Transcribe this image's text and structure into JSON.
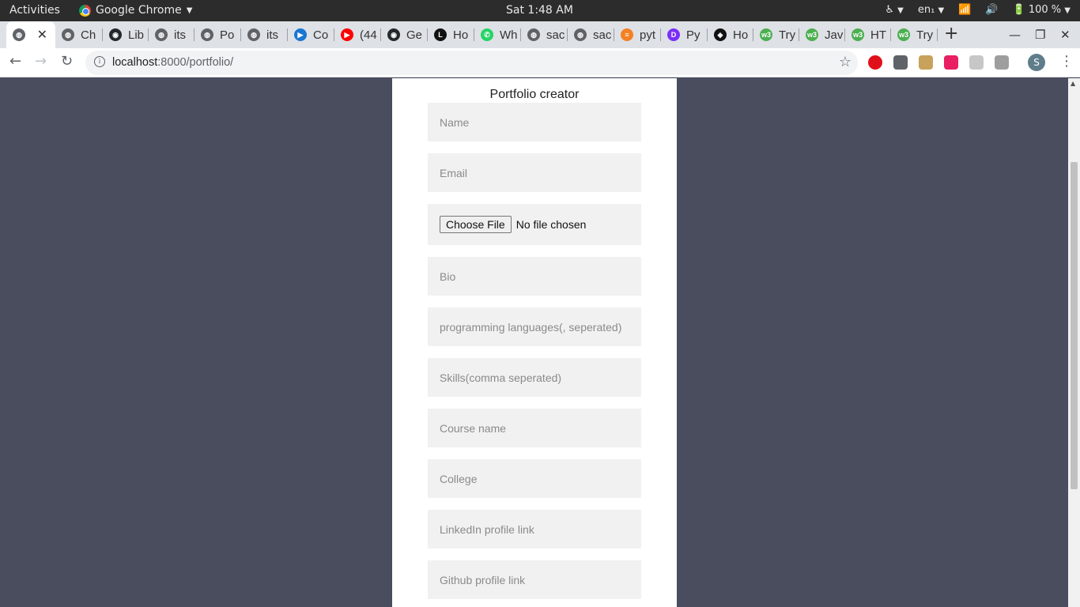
{
  "system": {
    "activities": "Activities",
    "app_name": "Google Chrome",
    "clock": "Sat  1:48 AM",
    "lang": "en₁",
    "battery": "100 %"
  },
  "tabs": [
    {
      "label": "",
      "favicon": "globe-icon",
      "color": "#5f6368",
      "active": true
    },
    {
      "label": "Ch",
      "favicon": "globe-icon",
      "color": "#5f6368"
    },
    {
      "label": "Lib",
      "favicon": "github-icon",
      "color": "#24292e"
    },
    {
      "label": "its",
      "favicon": "globe-icon",
      "color": "#5f6368"
    },
    {
      "label": "Po",
      "favicon": "globe-icon",
      "color": "#5f6368"
    },
    {
      "label": "its",
      "favicon": "globe-icon",
      "color": "#5f6368"
    },
    {
      "label": "Co",
      "favicon": "video-icon",
      "color": "#1976d2"
    },
    {
      "label": "(44",
      "favicon": "youtube-icon",
      "color": "#ff0000"
    },
    {
      "label": "Ge",
      "favicon": "github-icon",
      "color": "#24292e"
    },
    {
      "label": "Ho",
      "favicon": "letter-l-icon",
      "color": "#111111"
    },
    {
      "label": "Wh",
      "favicon": "whatsapp-icon",
      "color": "#25d366"
    },
    {
      "label": "sac",
      "favicon": "globe-icon",
      "color": "#5f6368"
    },
    {
      "label": "sac",
      "favicon": "globe-icon",
      "color": "#5f6368"
    },
    {
      "label": "pyt",
      "favicon": "stackoverflow-icon",
      "color": "#f48024"
    },
    {
      "label": "Py",
      "favicon": "jetbrains-icon",
      "color": "#7b2ff7"
    },
    {
      "label": "Ho",
      "favicon": "codepen-icon",
      "color": "#111111"
    },
    {
      "label": "Try",
      "favicon": "w3schools-icon",
      "color": "#4caf50"
    },
    {
      "label": "Jav",
      "favicon": "w3schools-icon",
      "color": "#4caf50"
    },
    {
      "label": "HT",
      "favicon": "w3schools-icon",
      "color": "#4caf50"
    },
    {
      "label": "Try",
      "favicon": "w3schools-icon",
      "color": "#4caf50"
    }
  ],
  "toolbar": {
    "url_host": "localhost",
    "url_path": ":8000/portfolio/",
    "avatar_letter": "S"
  },
  "extensions": [
    {
      "name": "opera-icon",
      "color": "#e0101a"
    },
    {
      "name": "facebook-icon",
      "color": "#5f6368"
    },
    {
      "name": "palette-icon",
      "color": "#c8a15a"
    },
    {
      "name": "color-picker-icon",
      "color": "#e91e63"
    },
    {
      "name": "vector-icon",
      "color": "#c7c7c7"
    },
    {
      "name": "mouse-icon",
      "color": "#9e9e9e"
    }
  ],
  "form": {
    "title": "Portfolio creator",
    "name_placeholder": "Name",
    "email_placeholder": "Email",
    "file_button": "Choose File",
    "file_status": "No file chosen",
    "bio_placeholder": "Bio",
    "languages_placeholder": "programming languages(, seperated)",
    "skills_placeholder": "Skills(comma seperated)",
    "course_placeholder": "Course name",
    "college_placeholder": "College",
    "linkedin_placeholder": "LinkedIn profile link",
    "github_placeholder": "Github profile link"
  }
}
